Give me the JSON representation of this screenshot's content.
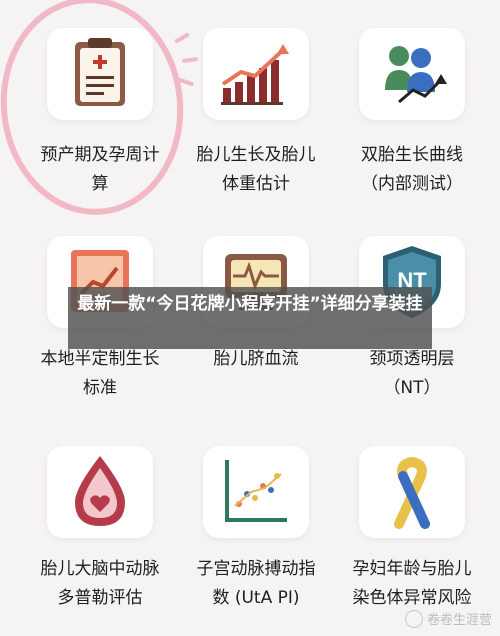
{
  "tools": [
    {
      "label_line1": "预产期及孕周计",
      "label_line2": "算",
      "icon": "clipboard-icon"
    },
    {
      "label_line1": "胎儿生长及胎儿",
      "label_line2": "体重估计",
      "icon": "growth-chart-icon"
    },
    {
      "label_line1": "双胎生长曲线",
      "label_line2": "（内部测试）",
      "icon": "twins-chart-icon"
    },
    {
      "label_line1": "本地半定制生长",
      "label_line2": "标准",
      "icon": "custom-chart-icon"
    },
    {
      "label_line1": "胎儿脐血流",
      "label_line2": "",
      "icon": "monitor-icon"
    },
    {
      "label_line1": "颈项透明层",
      "label_line2": "（NT）",
      "icon": "nt-shield-icon"
    },
    {
      "label_line1": "胎儿大脑中动脉",
      "label_line2": "多普勒评估",
      "icon": "blood-drop-icon"
    },
    {
      "label_line1": "子宫动脉搏动指",
      "label_line2": "数 (UtA PI)",
      "icon": "scatter-chart-icon"
    },
    {
      "label_line1": "孕妇年龄与胎儿",
      "label_line2": "染色体异常风险",
      "icon": "ribbon-icon"
    }
  ],
  "overlay_text": "最新一款“今日花牌小程序开挂”详细分享装挂",
  "watermark_text": "卷卷生涯营",
  "colors": {
    "accent": "#c0392b",
    "annotation": "#f0b9c5",
    "tile_bg": "#ffffff",
    "page_bg": "#f6f3f4"
  }
}
